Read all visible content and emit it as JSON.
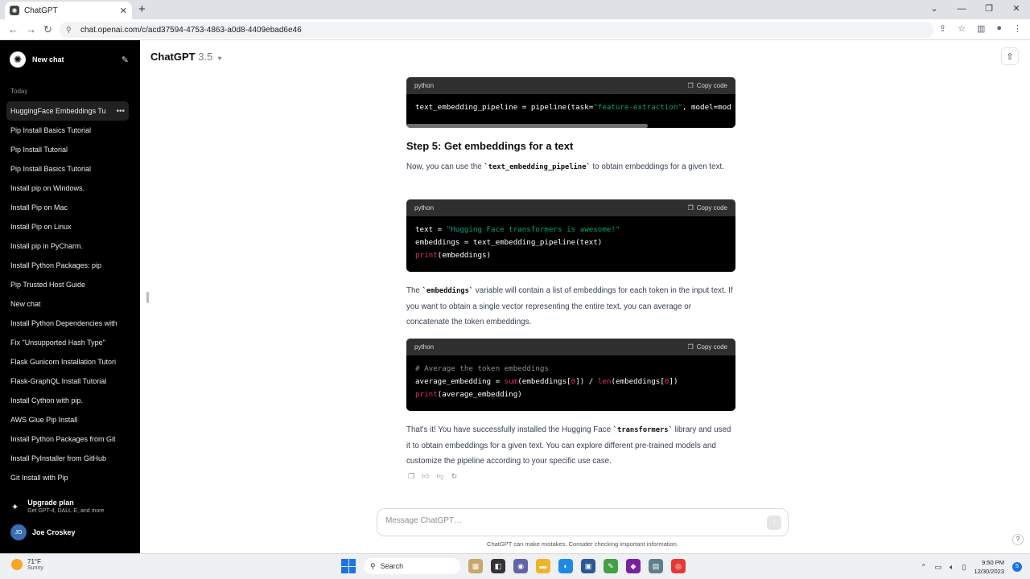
{
  "browser": {
    "tab_title": "ChatGPT",
    "url": "chat.openai.com/c/acd37594-4753-4863-a0d8-4409ebad6e46"
  },
  "sidebar": {
    "new_chat": "New chat",
    "section": "Today",
    "items": [
      {
        "label": "HuggingFace Embeddings Tu"
      },
      {
        "label": "Pip Install Basics Tutorial"
      },
      {
        "label": "Pip Install Tutorial"
      },
      {
        "label": "Pip Install Basics Tutorial"
      },
      {
        "label": "Install pip on Windows."
      },
      {
        "label": "Install Pip on Mac"
      },
      {
        "label": "Install Pip on Linux"
      },
      {
        "label": "Install pip in PyCharm."
      },
      {
        "label": "Install Python Packages: pip"
      },
      {
        "label": "Pip Trusted Host Guide"
      },
      {
        "label": "New chat"
      },
      {
        "label": "Install Python Dependencies with"
      },
      {
        "label": "Fix \"Unsupported Hash Type\""
      },
      {
        "label": "Flask Gunicorn Installation Tutori"
      },
      {
        "label": "Flask-GraphQL Install Tutorial"
      },
      {
        "label": "Install Cython with pip."
      },
      {
        "label": "AWS Glue Pip Install"
      },
      {
        "label": "Install Python Packages from Git"
      },
      {
        "label": "Install PyInstaller from GitHub"
      },
      {
        "label": "Git Install with Pip"
      }
    ],
    "upgrade_title": "Upgrade plan",
    "upgrade_sub": "Get GPT-4, DALL·E, and more",
    "user_initials": "JO",
    "user_name": "Joe Croskey"
  },
  "header": {
    "model": "ChatGPT",
    "version": "3.5"
  },
  "content": {
    "lang": "python",
    "copy_label": "Copy code",
    "step_heading": "Step 5: Get embeddings for a text",
    "p1_a": "Now, you can use the ",
    "p1_code": "`text_embedding_pipeline`",
    "p1_b": " to obtain embeddings for a given text.",
    "p2_a": "The ",
    "p2_code": "`embeddings`",
    "p2_b": " variable will contain a list of embeddings for each token in the input text. If you want to obtain a single vector representing the entire text, you can average or concatenate the token embeddings.",
    "p3_a": "That's it! You have successfully installed the Hugging Face ",
    "p3_code": "`transformers`",
    "p3_b": " library and used it to obtain embeddings for a given text. You can explore different pre-trained models and customize the pipeline according to your specific use case.",
    "code1": {
      "a": "text_embedding_pipeline = pipeline(task=",
      "s": "\"feature-extraction\"",
      "b": ", model=mod"
    },
    "code2": {
      "l1a": "text = ",
      "l1s": "\"Hugging Face transformers is awesome!\"",
      "l2": "embeddings = text_embedding_pipeline(text)",
      "l3f": "print",
      "l3b": "(embeddings)"
    },
    "code3": {
      "cmt": "# Average the token embeddings",
      "l2a": "average_embedding = ",
      "l2f1": "sum",
      "l2b": "(embeddings[",
      "n0": "0",
      "l2c": "]) / ",
      "l2f2": "len",
      "l2d": "(embeddings[",
      "n1": "0",
      "l2e": "])",
      "l3f": "print",
      "l3b": "(average_embedding)"
    }
  },
  "composer": {
    "placeholder": "Message ChatGPT…",
    "disclaimer": "ChatGPT can make mistakes. Consider checking important information.",
    "help": "?"
  },
  "taskbar": {
    "temp": "71°F",
    "condition": "Sunny",
    "search": "Search",
    "time": "9:50 PM",
    "date": "12/30/2023",
    "notifications": "5"
  }
}
